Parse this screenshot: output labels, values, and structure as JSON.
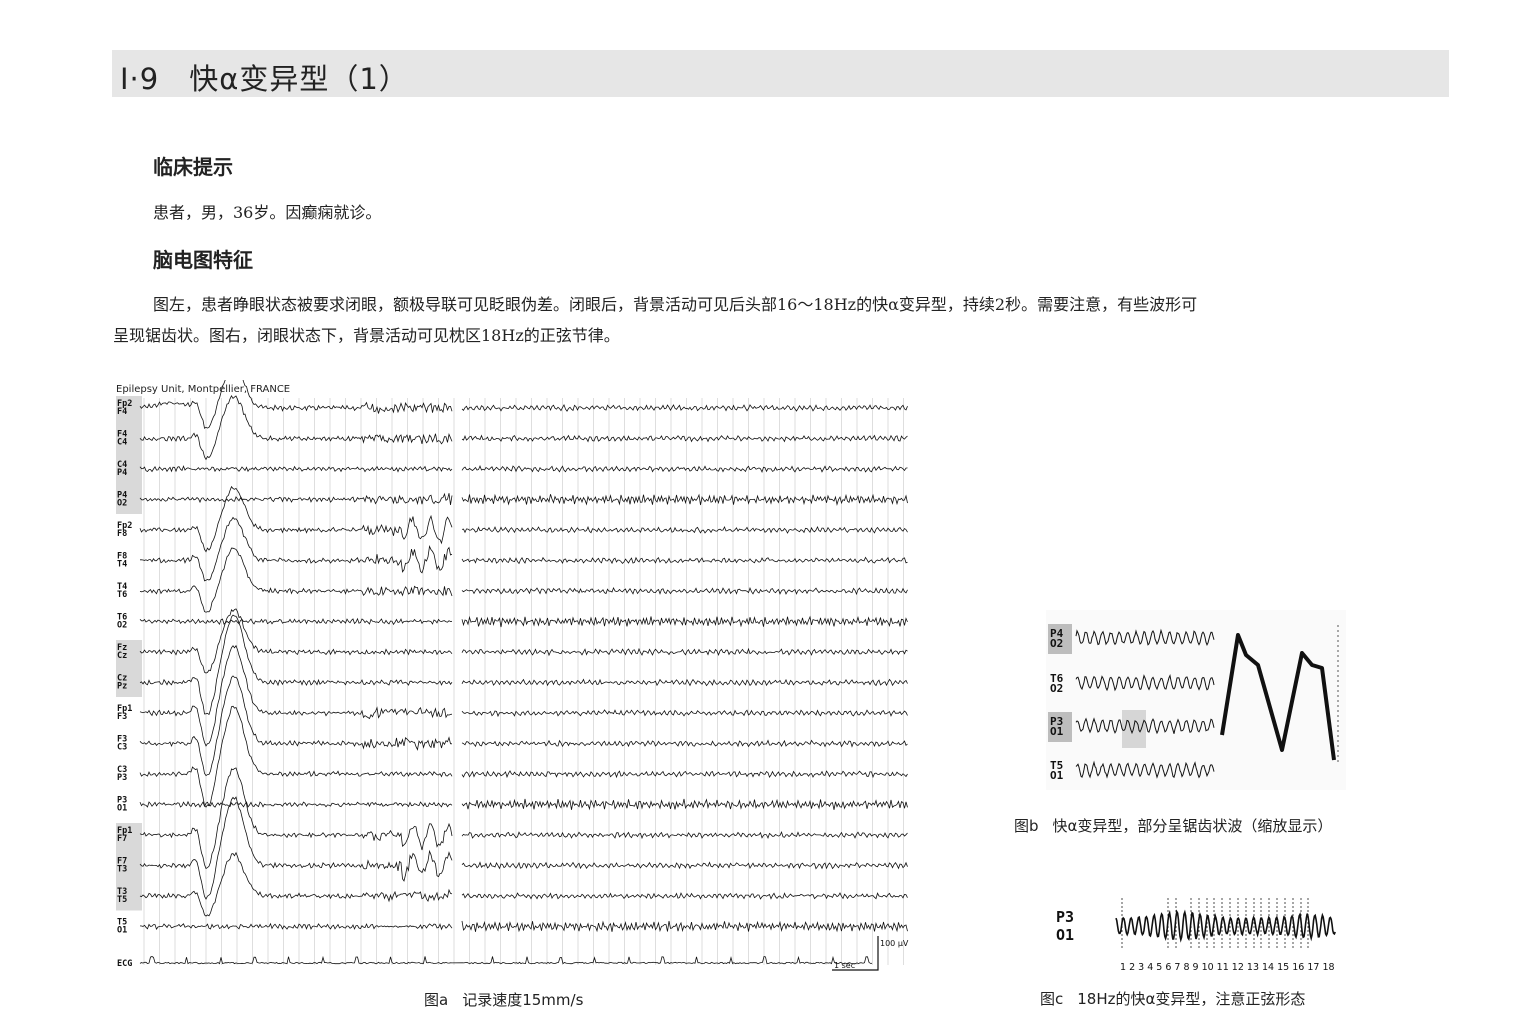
{
  "page": {
    "section_title": "Ⅰ·9　快α变异型（1）"
  },
  "clinical": {
    "heading": "临床提示",
    "text": "患者，男，36岁。因癫痫就诊。"
  },
  "eeg": {
    "heading": "脑电图特征",
    "paragraph_line1": "图左，患者睁眼状态被要求闭眼，额极导联可见眨眼伪差。闭眼后，背景活动可见后头部16～18Hz的快α变异型，持续2秒。需要注意，有些波形可",
    "paragraph_line2": "呈现锯齿状。图右，闭眼状态下，背景活动可见枕区18Hz的正弦节律。"
  },
  "figure_a": {
    "lab_label": "Epilepsy Unit, Montpellier, FRANCE",
    "channels": [
      [
        "Fp2",
        "F4"
      ],
      [
        "F4",
        "C4"
      ],
      [
        "C4",
        "P4"
      ],
      [
        "P4",
        "O2"
      ],
      [
        "Fp2",
        "F8"
      ],
      [
        "F8",
        "T4"
      ],
      [
        "T4",
        "T6"
      ],
      [
        "T6",
        "O2"
      ],
      [
        "Fz",
        "Cz"
      ],
      [
        "Cz",
        "Pz"
      ],
      [
        "Fp1",
        "F3"
      ],
      [
        "F3",
        "C3"
      ],
      [
        "C3",
        "P3"
      ],
      [
        "P3",
        "O1"
      ],
      [
        "Fp1",
        "F7"
      ],
      [
        "F7",
        "T3"
      ],
      [
        "T3",
        "T5"
      ],
      [
        "T5",
        "O1"
      ]
    ],
    "ecg_label": "ECG",
    "scale_amplitude": "100 μV",
    "scale_time": "1 sec",
    "caption_num": "图a",
    "caption_text": "记录速度15mm/s"
  },
  "figure_b": {
    "channels": [
      [
        "P4",
        "O2"
      ],
      [
        "T6",
        "O2"
      ],
      [
        "P3",
        "O1"
      ],
      [
        "T5",
        "O1"
      ]
    ],
    "caption_num": "图b",
    "caption_text": "快α变异型，部分呈锯齿状波（缩放显示）"
  },
  "figure_c": {
    "channel_top": "P3",
    "channel_bottom": "O1",
    "wave_numbers": "1 2 3 4 5 6 7 8 9 10 11 12 13 14 15 16 17 18",
    "caption_num": "图c",
    "caption_text": "18Hz的快α变异型，注意正弦形态"
  }
}
